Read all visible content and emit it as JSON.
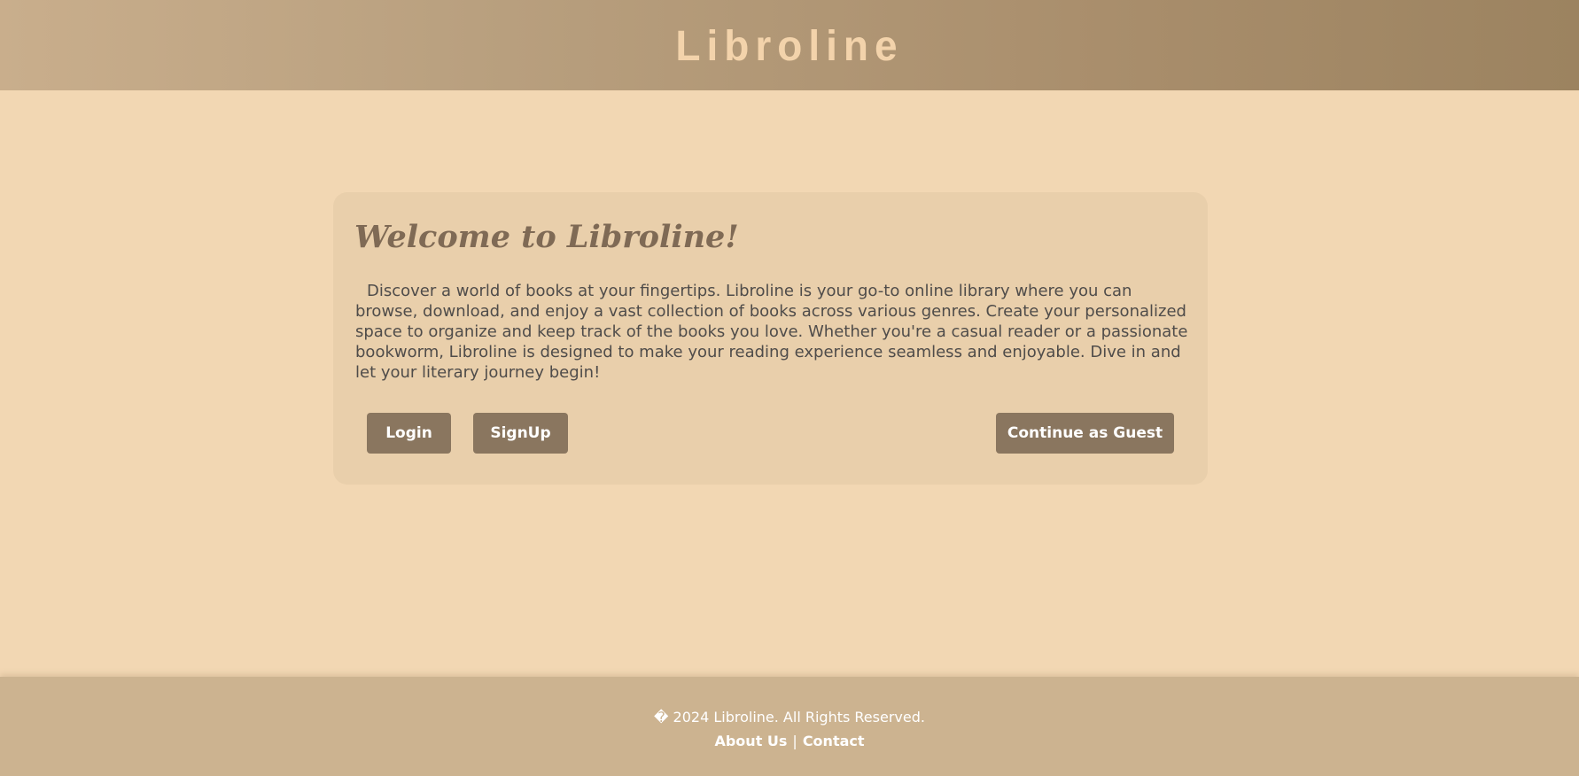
{
  "header": {
    "brand": "Libroline"
  },
  "welcome_card": {
    "title": "Welcome to Libroline!",
    "description": "Discover a world of books at your fingertips. Libroline is your go-to online library where you can browse, download, and enjoy a vast collection of books across various genres. Create your personalized space to organize and keep track of the books you love. Whether you're a casual reader or a passionate bookworm, Libroline is designed to make your reading experience seamless and enjoyable. Dive in and let your literary journey begin!",
    "login_label": "Login",
    "signup_label": "SignUp",
    "guest_label": "Continue as Guest"
  },
  "footer": {
    "copyright": "� 2024 Libroline. All Rights Reserved.",
    "links": [
      {
        "label": "About Us"
      },
      {
        "label": "Contact"
      }
    ],
    "separator": "|"
  },
  "colors": {
    "page_background": "#f2d7b3",
    "card_background": "#e9cfab",
    "button_background": "#8a765f",
    "footer_background": "#ccb390",
    "brand_text": "#f3d3ab",
    "title_text": "#7f6a55"
  }
}
